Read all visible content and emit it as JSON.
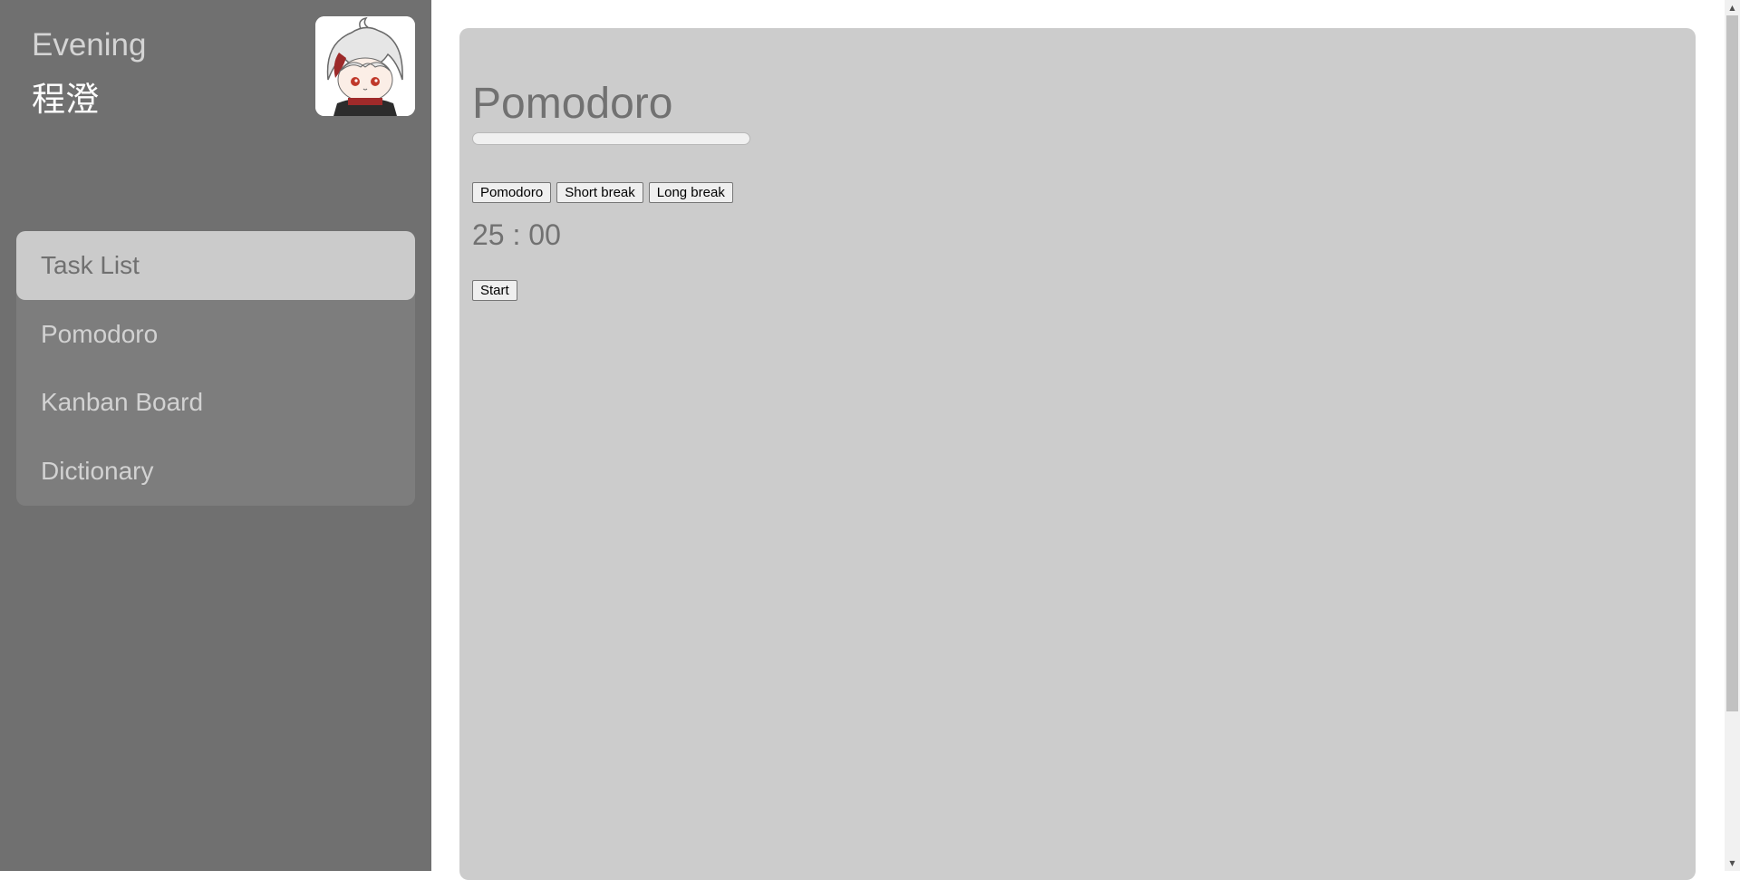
{
  "sidebar": {
    "greeting": "Evening",
    "username": "程澄",
    "avatar_icon": "chibi-character-avatar",
    "nav_items": [
      {
        "label": "Task List",
        "active": true
      },
      {
        "label": "Pomodoro",
        "active": false
      },
      {
        "label": "Kanban Board",
        "active": false
      },
      {
        "label": "Dictionary",
        "active": false
      }
    ]
  },
  "main": {
    "title": "Pomodoro",
    "progress": 0,
    "mode_buttons": [
      "Pomodoro",
      "Short break",
      "Long break"
    ],
    "timer": {
      "minutes": "25",
      "separator": ":",
      "seconds": "00"
    },
    "start_label": "Start"
  },
  "colors": {
    "sidebar_bg": "#707070",
    "nav_bg": "#7d7d7d",
    "nav_active_bg": "#cbcbcb",
    "panel_bg": "#cccccc",
    "page_bg": "#ffffff"
  }
}
